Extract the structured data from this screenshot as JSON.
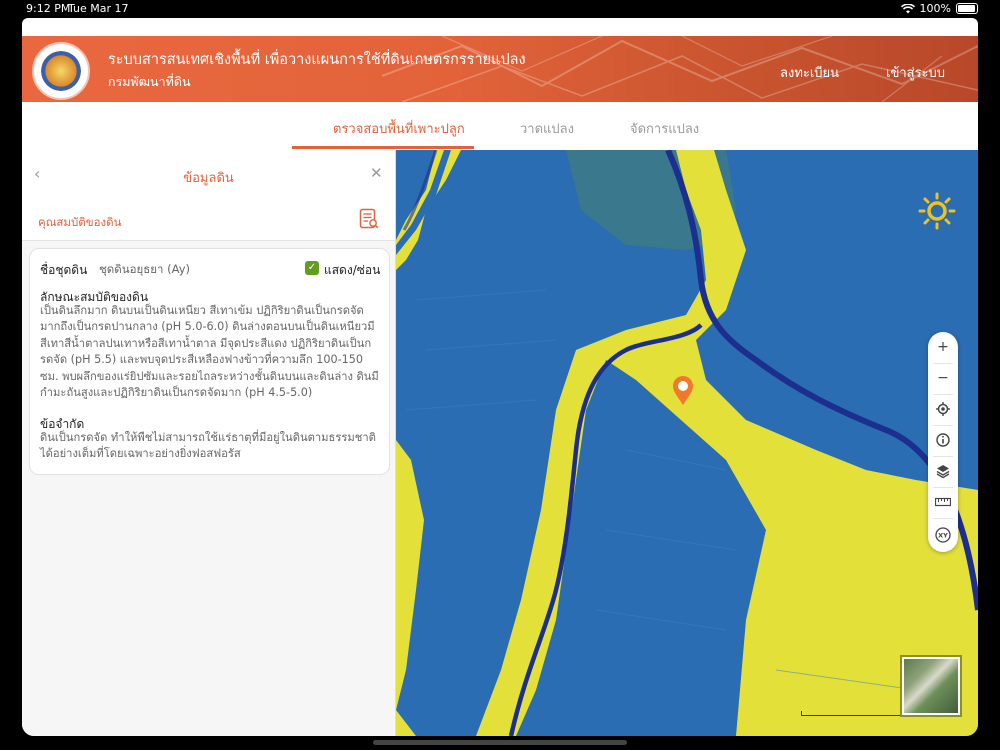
{
  "status_bar": {
    "time": "9:12 PM",
    "date": "Tue Mar 17",
    "battery": "100%"
  },
  "header": {
    "title": "ระบบสารสนเทศเชิงพื้นที่ เพื่อวางแผนการใช้ที่ดินเกษตรกรรายแปลง",
    "subtitle": "กรมพัฒนาที่ดิน",
    "register": "ลงทะเบียน",
    "login": "เข้าสู่ระบบ"
  },
  "tabs": [
    {
      "label": "ตรวจสอบพื้นที่เพาะปลูก",
      "active": true
    },
    {
      "label": "วาดแปลง",
      "active": false
    },
    {
      "label": "จัดการแปลง",
      "active": false
    }
  ],
  "panel": {
    "title": "ข้อมูลดิน",
    "section_label": "คุณสมบัติของดิน",
    "soil_name_label": "ชื่อชุดดิน",
    "soil_name_value": "ชุดดินอยุธยา (Ay)",
    "toggle_label": "แสดง/ซ่อน",
    "toggle_checked": true,
    "properties_heading": "ลักษณะสมบัติของดิน",
    "properties_text": "เป็นดินลึกมาก ดินบนเป็นดินเหนียว สีเทาเข้ม ปฏิกิริยาดินเป็นกรดจัดมากถึงเป็นกรดปานกลาง (pH 5.0-6.0) ดินล่างตอนบนเป็นดินเหนียวมีสีเทาสีน้ำตาลปนเทาหรือสีเทาน้ำตาล มีจุดประสีแดง ปฏิกิริยาดินเป็นกรดจัด (pH 5.5) และพบจุดประสีเหลืองฟางข้าวที่ความลึก 100-150 ซม. พบผลึกของแร่ยิปซัมและรอยไถลระหว่างชั้นดินบนและดินล่าง ดินมีกำมะถันสูงและปฏิกิริยาดินเป็นกรดจัดมาก (pH 4.5-5.0)",
    "limitation_heading": "ข้อจำกัด",
    "limitation_text": "ดินเป็นกรดจัด ทำให้พืชไม่สามารถใช้แร่ธาตุที่มีอยู่ในดินตามธรรมชาติได้อย่างเต็มที่โดยเฉพาะอย่างยิ่งฟอสฟอรัส"
  },
  "map_tools": {
    "xy_label": "XY",
    "tools": [
      "zoom-in-icon",
      "zoom-out-icon",
      "locate-icon",
      "info-icon",
      "layers-icon",
      "ruler-icon",
      "xy-icon"
    ]
  },
  "colors": {
    "accent": "#e0633b",
    "map_water": "#2a6fb5",
    "map_soil": "#e3e03a",
    "river": "#1c2f8f"
  }
}
